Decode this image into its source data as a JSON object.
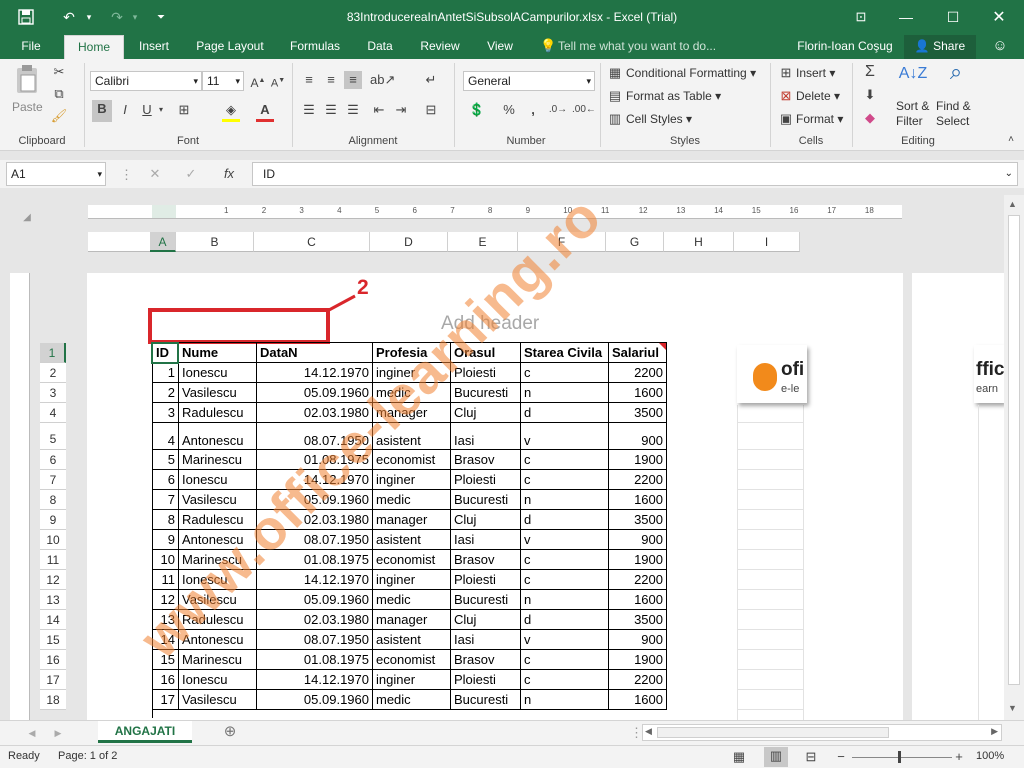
{
  "window": {
    "title": "83IntroducereaInAntetSiSubsolACampurilor.xlsx - Excel (Trial)"
  },
  "tabs": [
    "File",
    "Home",
    "Insert",
    "Page Layout",
    "Formulas",
    "Data",
    "Review",
    "View"
  ],
  "tell_me": "Tell me what you want to do...",
  "user": "Florin-Ioan Coşug",
  "share_label": "Share",
  "ribbon": {
    "paste": "Paste",
    "font_name": "Calibri",
    "font_size": "11",
    "number_format": "General",
    "cond_format": "Conditional Formatting",
    "format_table": "Format as Table",
    "cell_styles": "Cell Styles",
    "insert": "Insert",
    "delete": "Delete",
    "format": "Format",
    "sort_filter": "Sort & Filter",
    "find_select": "Find & Select",
    "groups": {
      "clipboard": "Clipboard",
      "font": "Font",
      "alignment": "Alignment",
      "number": "Number",
      "styles": "Styles",
      "cells": "Cells",
      "editing": "Editing"
    }
  },
  "formula_bar": {
    "name_box": "A1",
    "content": "ID"
  },
  "columns": [
    "A",
    "B",
    "C",
    "D",
    "E",
    "F",
    "G",
    "H",
    "I"
  ],
  "ruler_marks": [
    "1",
    "2",
    "3",
    "4",
    "5",
    "6",
    "7",
    "8",
    "9",
    "10",
    "11",
    "12",
    "13",
    "14",
    "15",
    "16",
    "17",
    "18"
  ],
  "header_placeholder": "Add header",
  "annotation_number": "2",
  "table": {
    "headers": [
      "ID",
      "Nume",
      "DataN",
      "Profesia",
      "Orasul",
      "Starea Civila",
      "Salariul"
    ],
    "rows": [
      [
        "1",
        "Ionescu",
        "14.12.1970",
        "inginer",
        "Ploiesti",
        "c",
        "2200"
      ],
      [
        "2",
        "Vasilescu",
        "05.09.1960",
        "medic",
        "Bucuresti",
        "n",
        "1600"
      ],
      [
        "3",
        "Radulescu",
        "02.03.1980",
        "manager",
        "Cluj",
        "d",
        "3500"
      ],
      [
        "4",
        "Antonescu",
        "08.07.1950",
        "asistent",
        "Iasi",
        "v",
        "900"
      ],
      [
        "5",
        "Marinescu",
        "01.08.1975",
        "economist",
        "Brasov",
        "c",
        "1900"
      ],
      [
        "6",
        "Ionescu",
        "14.12.1970",
        "inginer",
        "Ploiesti",
        "c",
        "2200"
      ],
      [
        "7",
        "Vasilescu",
        "05.09.1960",
        "medic",
        "Bucuresti",
        "n",
        "1600"
      ],
      [
        "8",
        "Radulescu",
        "02.03.1980",
        "manager",
        "Cluj",
        "d",
        "3500"
      ],
      [
        "9",
        "Antonescu",
        "08.07.1950",
        "asistent",
        "Iasi",
        "v",
        "900"
      ],
      [
        "10",
        "Marinescu",
        "01.08.1975",
        "economist",
        "Brasov",
        "c",
        "1900"
      ],
      [
        "11",
        "Ionescu",
        "14.12.1970",
        "inginer",
        "Ploiesti",
        "c",
        "2200"
      ],
      [
        "12",
        "Vasilescu",
        "05.09.1960",
        "medic",
        "Bucuresti",
        "n",
        "1600"
      ],
      [
        "13",
        "Radulescu",
        "02.03.1980",
        "manager",
        "Cluj",
        "d",
        "3500"
      ],
      [
        "14",
        "Antonescu",
        "08.07.1950",
        "asistent",
        "Iasi",
        "v",
        "900"
      ],
      [
        "15",
        "Marinescu",
        "01.08.1975",
        "economist",
        "Brasov",
        "c",
        "1900"
      ],
      [
        "16",
        "Ionescu",
        "14.12.1970",
        "inginer",
        "Ploiesti",
        "c",
        "2200"
      ],
      [
        "17",
        "Vasilescu",
        "05.09.1960",
        "medic",
        "Bucuresti",
        "n",
        "1600"
      ]
    ]
  },
  "row_numbers": [
    "1",
    "2",
    "3",
    "4",
    "5",
    "6",
    "7",
    "8",
    "9",
    "10",
    "11",
    "12",
    "13",
    "14",
    "15",
    "16",
    "17",
    "18"
  ],
  "logo": {
    "text": "ofi",
    "sub": "e-le",
    "text2": "ffic",
    "sub2": "earn"
  },
  "watermark": "www.office-learning.ro",
  "sheet_tab": "ANGAJATI",
  "status": {
    "ready": "Ready",
    "page": "Page: 1 of 2",
    "zoom": "100%"
  },
  "colors": {
    "accent": "#217346",
    "annotation": "#d9262b",
    "watermark": "#f08232"
  }
}
